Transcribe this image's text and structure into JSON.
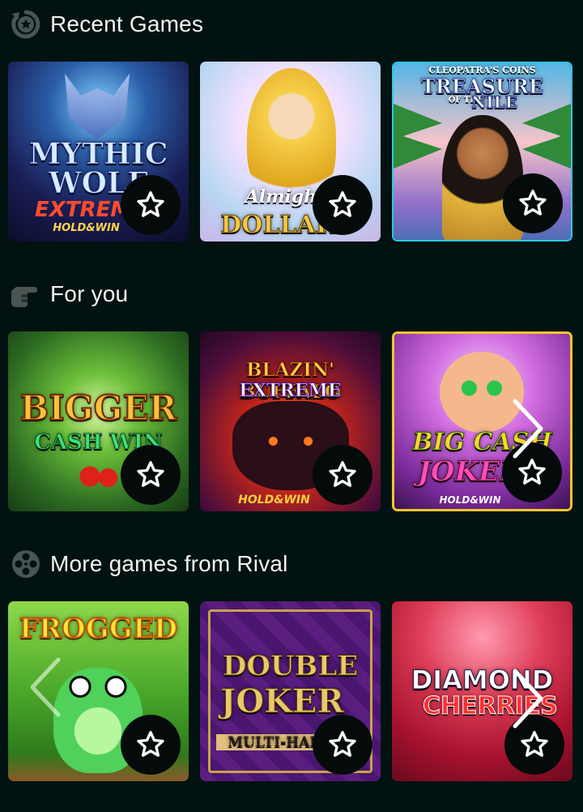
{
  "sections": {
    "recent": {
      "title": "Recent Games",
      "icon": "history-star-icon",
      "games": [
        {
          "title": "MYTHIC WOLF",
          "subtitle": "EXTREME",
          "tag": "HOLD&WIN"
        },
        {
          "title": "Almighty",
          "subtitle": "DOLLAR"
        },
        {
          "title": "TREASURE",
          "subtitle": "NILE",
          "over": "CLEOPATRA'S COINS",
          "mid": "OF THE"
        }
      ]
    },
    "for_you": {
      "title": "For you",
      "icon": "pointing-hand-icon",
      "games": [
        {
          "title": "BIGGER",
          "subtitle": "CASH WIN"
        },
        {
          "title": "BLAZIN' BUFFALO",
          "subtitle": "EXTREME",
          "tag": "HOLD&WIN"
        },
        {
          "title": "BIG CASH",
          "subtitle": "JOKER",
          "tag": "HOLD&WIN"
        }
      ]
    },
    "rival": {
      "title": "More games from Rival",
      "icon": "film-reel-icon",
      "games": [
        {
          "title": "FROGGED"
        },
        {
          "title": "DOUBLE",
          "subtitle": "JOKER",
          "tag": "MULTI-HAND"
        },
        {
          "title": "DIAMOND",
          "subtitle": "CHERRIES"
        }
      ]
    }
  },
  "icons": {
    "favorite": "star-outline-icon",
    "prev": "chevron-left-icon",
    "next": "chevron-right-icon"
  },
  "colors": {
    "background": "#021210",
    "favorite_button": "#050b0a"
  }
}
